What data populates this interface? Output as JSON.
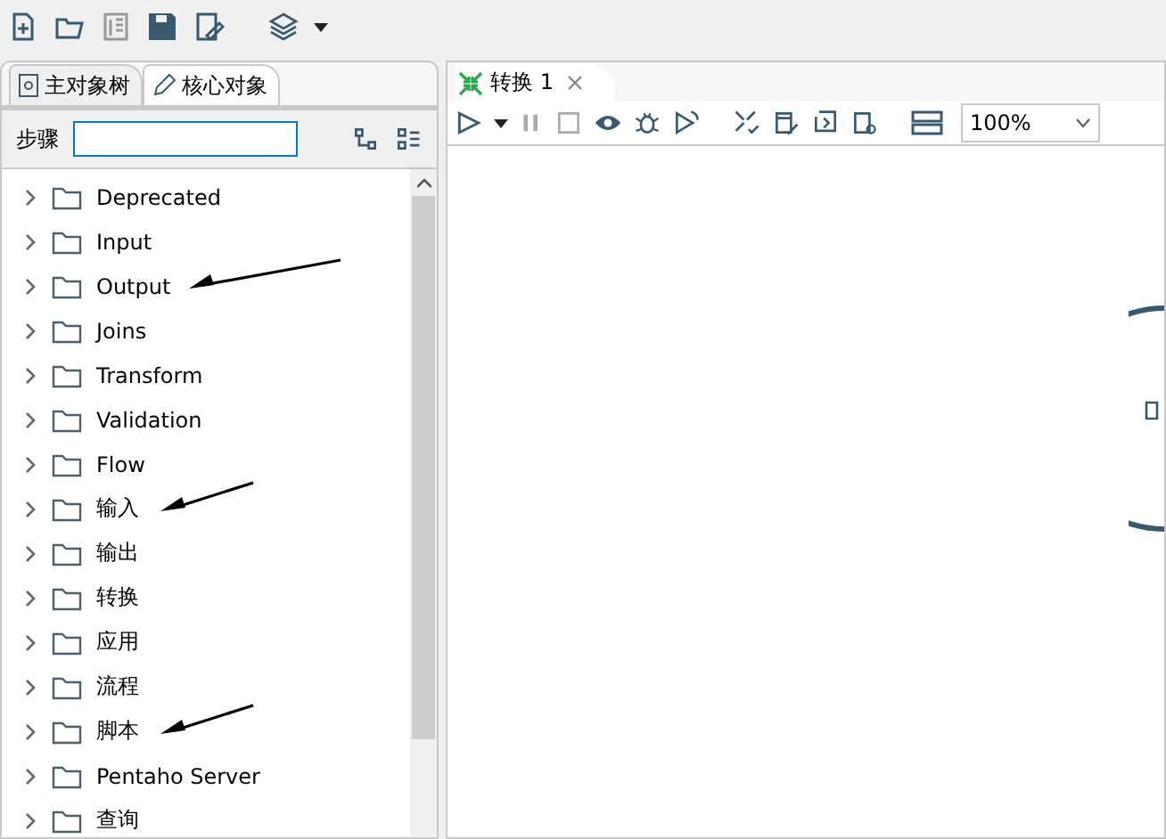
{
  "left_tabs": [
    {
      "label": "主对象树",
      "selected": false
    },
    {
      "label": "核心对象",
      "selected": true
    }
  ],
  "steps_search": {
    "label": "步骤"
  },
  "tree": [
    {
      "label": "Deprecated",
      "expanded": false,
      "annotated": false
    },
    {
      "label": "Input",
      "expanded": false,
      "annotated": false
    },
    {
      "label": "Output",
      "expanded": false,
      "annotated": true
    },
    {
      "label": "Joins",
      "expanded": false,
      "annotated": false
    },
    {
      "label": "Transform",
      "expanded": false,
      "annotated": false
    },
    {
      "label": "Validation",
      "expanded": false,
      "annotated": false
    },
    {
      "label": "Flow",
      "expanded": false,
      "annotated": false
    },
    {
      "label": "输入",
      "expanded": false,
      "annotated": true
    },
    {
      "label": "输出",
      "expanded": false,
      "annotated": false
    },
    {
      "label": "转换",
      "expanded": false,
      "annotated": false
    },
    {
      "label": "应用",
      "expanded": false,
      "annotated": false
    },
    {
      "label": "流程",
      "expanded": false,
      "annotated": false
    },
    {
      "label": "脚本",
      "expanded": false,
      "annotated": true
    },
    {
      "label": "Pentaho Server",
      "expanded": false,
      "annotated": false
    },
    {
      "label": "查询",
      "expanded": false,
      "annotated": false
    }
  ],
  "editor_tab": {
    "label": "转换 1",
    "selected": true
  },
  "zoom": {
    "value": "100%"
  }
}
